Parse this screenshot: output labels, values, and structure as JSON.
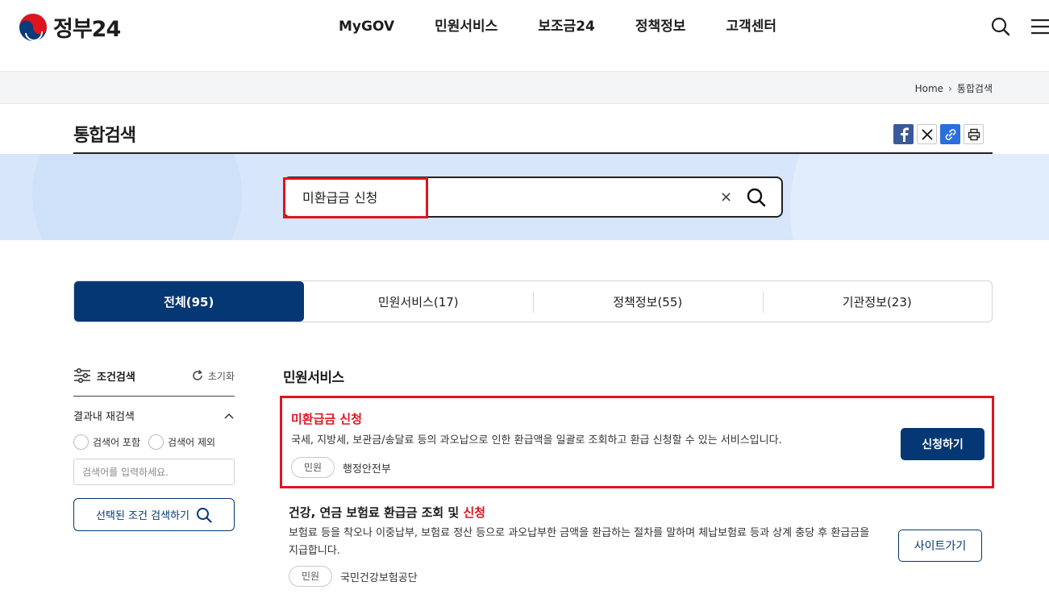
{
  "header": {
    "logo_text": "정부24",
    "nav": [
      "MyGOV",
      "민원서비스",
      "보조금24",
      "정책정보",
      "고객센터"
    ]
  },
  "breadcrumb": {
    "home": "Home",
    "current": "통합검색"
  },
  "page": {
    "title": "통합검색"
  },
  "search": {
    "value": "미환급금 신청",
    "clear": "×"
  },
  "tabs": [
    {
      "label": "전체(95)",
      "active": true
    },
    {
      "label": "민원서비스(17)",
      "active": false
    },
    {
      "label": "정책정보(55)",
      "active": false
    },
    {
      "label": "기관정보(23)",
      "active": false
    }
  ],
  "filter": {
    "title": "조건검색",
    "reset": "초기화",
    "refine_title": "결과내 재검색",
    "option_include": "검색어 포함",
    "option_exclude": "검색어 제외",
    "input_placeholder": "검색어를 입력하세요.",
    "submit": "선택된 조건 검색하기"
  },
  "results": {
    "section_title": "민원서비스",
    "items": [
      {
        "title": "미환급금 신청",
        "description": "국세, 지방세, 보관금/송달료 등의 과오납으로 인한 환급액을 일괄로 조회하고 환급 신청할 수 있는 서비스입니다.",
        "chip": "민원",
        "agency": "행정안전부",
        "button": "신청하기"
      },
      {
        "title_prefix": "건강, 연금 보험료 환급금 조회 및 ",
        "title_highlight": "신청",
        "description": "보험료 등을 착오나 이중납부, 보험료 정산 등으로 과오납부한 금액을 환급하는 절차를 말하며 체납보험료 등과 상계 충당 후 환급금을 지급합니다.",
        "chip": "민원",
        "agency": "국민건강보험공단",
        "button": "사이트가기"
      }
    ]
  },
  "colors": {
    "primary": "#043773",
    "highlight": "#e0141e",
    "hero_bg": "#d7e6fb"
  }
}
